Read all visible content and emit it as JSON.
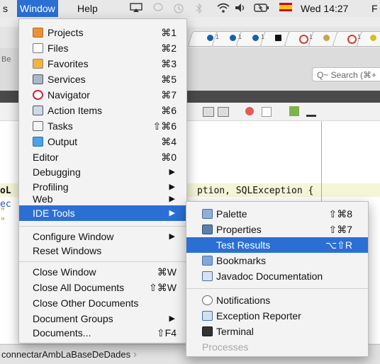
{
  "menubar": {
    "app_partial": "s",
    "window_menu": "Window",
    "help_menu": "Help",
    "clock": "Wed 14:27",
    "trailing_partial": "F"
  },
  "browser_tabs": [
    "1",
    "1",
    "1",
    "",
    "1",
    "1"
  ],
  "ide": {
    "side_partial": "Be",
    "search_placeholder": "Q~ Search (⌘+",
    "code_lines": [
      "ption, SQLException {",
      ";"
    ],
    "gutter_partial": [
      "oL",
      "ec",
      "\"",
      "\"",
      "\""
    ],
    "breadcrumb": "connectarAmbLaBaseDeDades",
    "breadcrumb_chevron": "›"
  },
  "window_menu": {
    "items": [
      {
        "label": "Projects",
        "shortcut": "⌘1",
        "icon": "projects-icon"
      },
      {
        "label": "Files",
        "shortcut": "⌘2",
        "icon": "files-icon"
      },
      {
        "label": "Favorites",
        "shortcut": "⌘3",
        "icon": "favorites-icon"
      },
      {
        "label": "Services",
        "shortcut": "⌘5",
        "icon": "services-icon"
      },
      {
        "label": "Navigator",
        "shortcut": "⌘7",
        "icon": "navigator-icon"
      },
      {
        "label": "Action Items",
        "shortcut": "⌘6",
        "icon": "action-items-icon"
      },
      {
        "label": "Tasks",
        "shortcut": "⇧⌘6",
        "icon": "tasks-icon"
      },
      {
        "label": "Output",
        "shortcut": "⌘4",
        "icon": "output-icon"
      },
      {
        "label": "Editor",
        "shortcut": "⌘0"
      },
      {
        "label": "Debugging",
        "submenu": "▶"
      },
      {
        "label": "Profiling",
        "submenu": "▶"
      },
      {
        "label": "Web",
        "submenu": "▶"
      },
      {
        "label": "IDE Tools",
        "submenu": "▶",
        "selected": true
      },
      {
        "label": "Configure Window",
        "submenu": "▶"
      },
      {
        "label": "Reset Windows"
      },
      {
        "label": "Close Window",
        "shortcut": "⌘W"
      },
      {
        "label": "Close All Documents",
        "shortcut": "⇧⌘W"
      },
      {
        "label": "Close Other Documents"
      },
      {
        "label": "Document Groups",
        "submenu": "▶"
      },
      {
        "label": "Documents...",
        "shortcut": "⇧F4"
      }
    ]
  },
  "ide_tools_menu": {
    "items": [
      {
        "label": "Palette",
        "shortcut": "⇧⌘8",
        "icon": "palette-icon"
      },
      {
        "label": "Properties",
        "shortcut": "⇧⌘7",
        "icon": "properties-icon"
      },
      {
        "label": "Test Results",
        "shortcut": "⌥⇧R",
        "icon": "test-results-icon",
        "selected": true
      },
      {
        "label": "Bookmarks",
        "icon": "bookmarks-icon"
      },
      {
        "label": "Javadoc Documentation",
        "icon": "javadoc-icon"
      },
      {
        "label": "Notifications",
        "icon": "notifications-icon"
      },
      {
        "label": "Exception Reporter",
        "icon": "exception-reporter-icon"
      },
      {
        "label": "Terminal",
        "icon": "terminal-icon"
      },
      {
        "label": "Processes",
        "disabled": true
      }
    ]
  },
  "colors": {
    "highlight": "#2b6fd4",
    "menu_bg": "#f3f3f3",
    "disabled_text": "#a8a8a8"
  }
}
